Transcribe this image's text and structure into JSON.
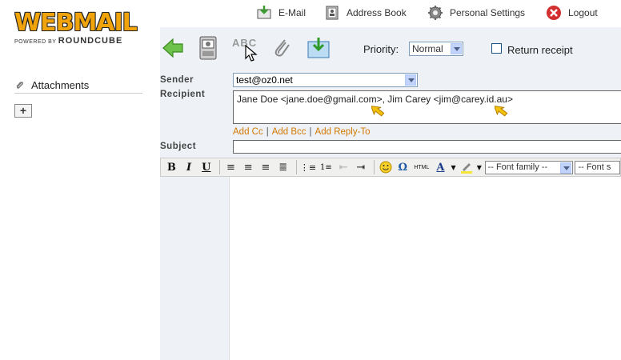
{
  "brand": {
    "title": "WEBMAIL",
    "powered": "POWERED BY",
    "engine": "ROUNDCUBE"
  },
  "topnav": {
    "email": "E-Mail",
    "address_book": "Address Book",
    "settings": "Personal Settings",
    "logout": "Logout"
  },
  "sidebar": {
    "attachments_label": "Attachments",
    "add_button": "+"
  },
  "toolbar": {
    "priority_label": "Priority:",
    "priority_value": "Normal",
    "receipt_label": "Return receipt",
    "spell_label": "ABC"
  },
  "compose": {
    "sender_label": "Sender",
    "sender_value": "test@oz0.net",
    "recipient_label": "Recipient",
    "recipient_value": "Jane Doe <jane.doe@gmail.com>, Jim Carey <jim@carey.id.au>",
    "add_cc": "Add Cc",
    "add_bcc": "Add Bcc",
    "add_reply_to": "Add Reply-To",
    "subject_label": "Subject",
    "subject_value": ""
  },
  "editor": {
    "bold": "B",
    "italic": "I",
    "underline": "U",
    "html_label": "HTML",
    "font_family": "-- Font family --",
    "font_size": "-- Font s"
  },
  "colors": {
    "accent": "#d27700",
    "background": "#eef2f6",
    "logo": "#f0a30a"
  }
}
